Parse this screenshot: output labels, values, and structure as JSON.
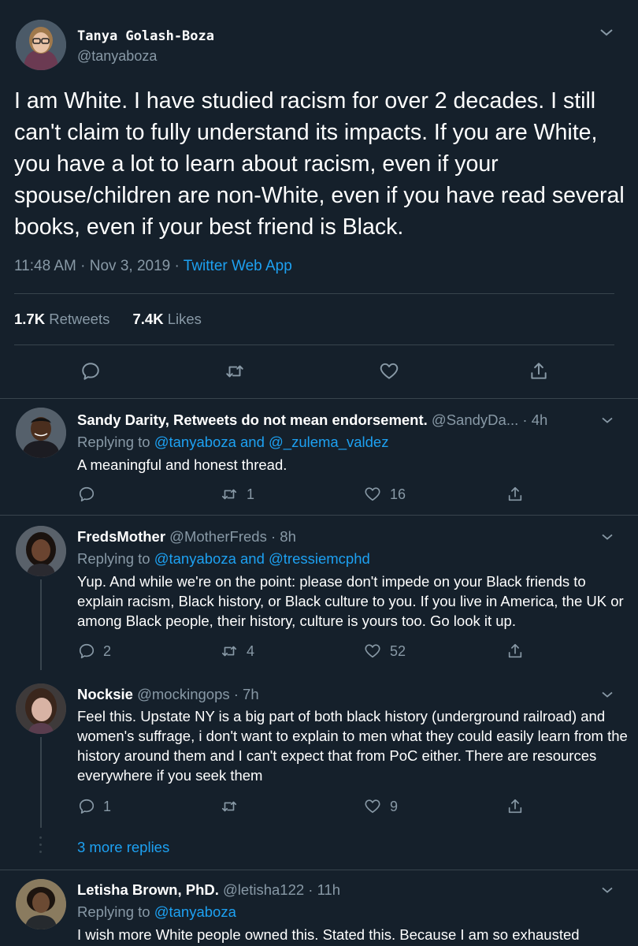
{
  "main_tweet": {
    "name": "Tanya Golash-Boza",
    "handle": "@tanyaboza",
    "text": "I am White. I have studied racism for over 2 decades. I still can't claim to fully understand its impacts. If you are White, you have a lot to learn about racism, even if your spouse/children are non-White, even if you have read several books, even if your best friend is Black.",
    "timestamp": "11:48 AM · Nov 3, 2019 · ",
    "source": "Twitter Web App",
    "retweets_count": "1.7K",
    "retweets_label": " Retweets",
    "likes_count": "7.4K",
    "likes_label": " Likes"
  },
  "replies": [
    {
      "name": "Sandy Darity, Retweets do not mean endorsement.",
      "handle": " @SandyDa...",
      "time": " · 4h",
      "replying_label": "Replying to ",
      "replying_to": "@tanyaboza and @_zulema_valdez",
      "text": "A meaningful and honest thread.",
      "replies_count": "",
      "retweets_count": "1",
      "likes_count": "16"
    },
    {
      "name": "FredsMother",
      "handle": " @MotherFreds",
      "time": " · 8h",
      "replying_label": "Replying to ",
      "replying_to": "@tanyaboza and @tressiemcphd",
      "text": "Yup. And while we're on the point: please don't impede on your Black friends to explain racism, Black history, or Black culture to you. If you live in America, the UK or among Black people, their history, culture is yours too. Go look it up.",
      "replies_count": "2",
      "retweets_count": "4",
      "likes_count": "52"
    },
    {
      "name": "Nocksie",
      "handle": " @mockingops",
      "time": " · 7h",
      "text": "Feel this. Upstate NY is a big part of both black history (underground railroad) and women's suffrage, i don't want to explain to men what they could easily learn from the history around them and I can't expect that from PoC either. There are resources everywhere if you seek them",
      "replies_count": "1",
      "retweets_count": "",
      "likes_count": "9"
    },
    {
      "name": "Letisha Brown, PhD.",
      "handle": " @letisha122",
      "time": " · 11h",
      "replying_label": "Replying to ",
      "replying_to": "@tanyaboza",
      "text": "I wish more White people owned this. Stated this. Because I am so exhausted"
    }
  ],
  "more_replies": "3 more replies",
  "colors": {
    "background": "#15202b",
    "text": "#ffffff",
    "muted": "#8899a6",
    "link": "#1da1f2",
    "border": "#38444d"
  },
  "icons": [
    "chevron-down-icon",
    "reply-icon",
    "retweet-icon",
    "like-icon",
    "share-icon"
  ]
}
